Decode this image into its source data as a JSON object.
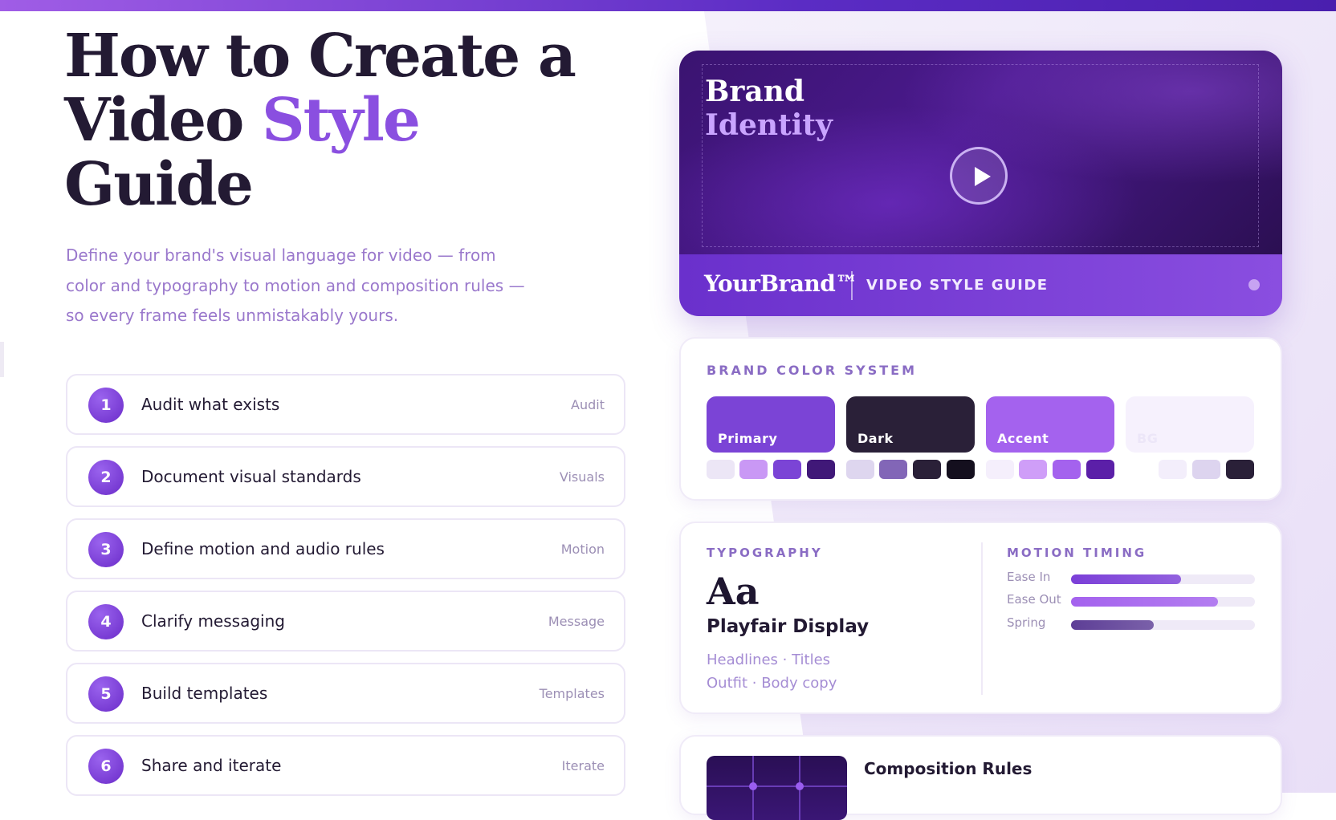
{
  "hero": {
    "title_line1": "How to Create a",
    "title_line2_plain": "Video ",
    "title_line2_accent": "Style",
    "title_line3": "Guide",
    "subtitle": "Define your brand's visual language for video — from color and typography to motion and composition rules — so every frame feels unmistakably yours."
  },
  "steps": [
    {
      "number": "1",
      "title": "Audit what exists",
      "tag": "Audit"
    },
    {
      "number": "2",
      "title": "Document visual standards",
      "tag": "Visuals"
    },
    {
      "number": "3",
      "title": "Define motion and audio rules",
      "tag": "Motion"
    },
    {
      "number": "4",
      "title": "Clarify messaging",
      "tag": "Message"
    },
    {
      "number": "5",
      "title": "Build templates",
      "tag": "Templates"
    },
    {
      "number": "6",
      "title": "Share and iterate",
      "tag": "Iterate"
    }
  ],
  "video": {
    "title_line1": "Brand",
    "title_line2": "Identity",
    "play_icon": "play-icon",
    "brand_name": "YourBrand™",
    "brand_subtitle": "VIDEO STYLE GUIDE"
  },
  "color_system": {
    "label": "BRAND COLOR SYSTEM",
    "swatches": [
      {
        "name": "Primary",
        "color": "#7b44d6",
        "text_color": "#ffffff",
        "tints": [
          "#ece6f6",
          "#c998f5",
          "#7b44d6",
          "#401878"
        ]
      },
      {
        "name": "Dark",
        "color": "#2a2038",
        "text_color": "#ffffff",
        "tints": [
          "#ded6ef",
          "#8266b7",
          "#2a2038",
          "#140f1e"
        ]
      },
      {
        "name": "Accent",
        "color": "#a462ee",
        "text_color": "#ffffff",
        "tints": [
          "#f5effc",
          "#cf9ef8",
          "#a462ee",
          "#5b1fa8"
        ]
      },
      {
        "name": "BG",
        "color": "#f6f1fd",
        "text_color": "#ece6f8",
        "tints": [
          "#ffffff",
          "#f3eefb",
          "#ddd4ef",
          "#2a2038"
        ]
      }
    ]
  },
  "typography": {
    "label": "TYPOGRAPHY",
    "sample": "Aa",
    "font_name": "Playfair Display",
    "line1": "Headlines · Titles",
    "line2": "Outfit · Body copy"
  },
  "motion": {
    "label": "MOTION TIMING",
    "rows": [
      {
        "name": "Ease In",
        "value": 0.6,
        "color": "#7b3fd8"
      },
      {
        "name": "Ease Out",
        "value": 0.8,
        "color": "#a462ee"
      },
      {
        "name": "Spring",
        "value": 0.45,
        "color": "#5d3e96"
      }
    ]
  },
  "composition": {
    "title": "Composition Rules"
  }
}
